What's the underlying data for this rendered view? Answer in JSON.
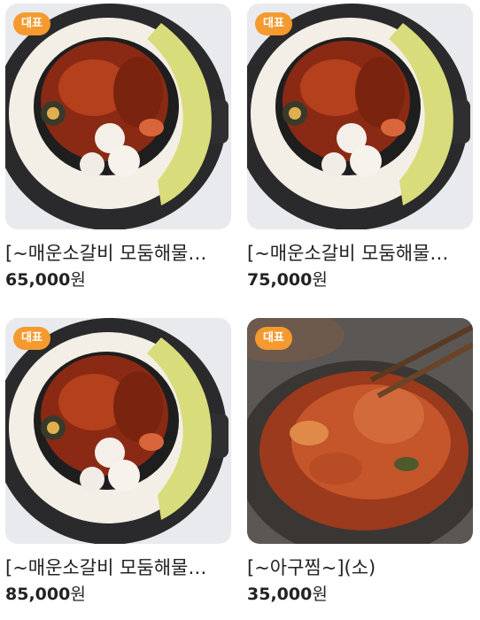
{
  "products": [
    {
      "badge": "대표",
      "name": "[~매운소갈비 모둠해물찜~]",
      "price": "65,000",
      "unit": "원",
      "photo": "spicy-galbi-seafood-pan"
    },
    {
      "badge": "대표",
      "name": "[~매운소갈비 모둠해물찜~]",
      "price": "75,000",
      "unit": "원",
      "photo": "spicy-galbi-seafood-pan"
    },
    {
      "badge": "대표",
      "name": "[~매운소갈비 모둠해물찜~]",
      "price": "85,000",
      "unit": "원",
      "photo": "spicy-galbi-seafood-pan"
    },
    {
      "badge": "대표",
      "name": "[~아구찜~](소)",
      "price": "35,000",
      "unit": "원",
      "photo": "braised-monkfish-bowl"
    }
  ],
  "colors": {
    "badge": "#f49a2f",
    "text": "#222222"
  }
}
